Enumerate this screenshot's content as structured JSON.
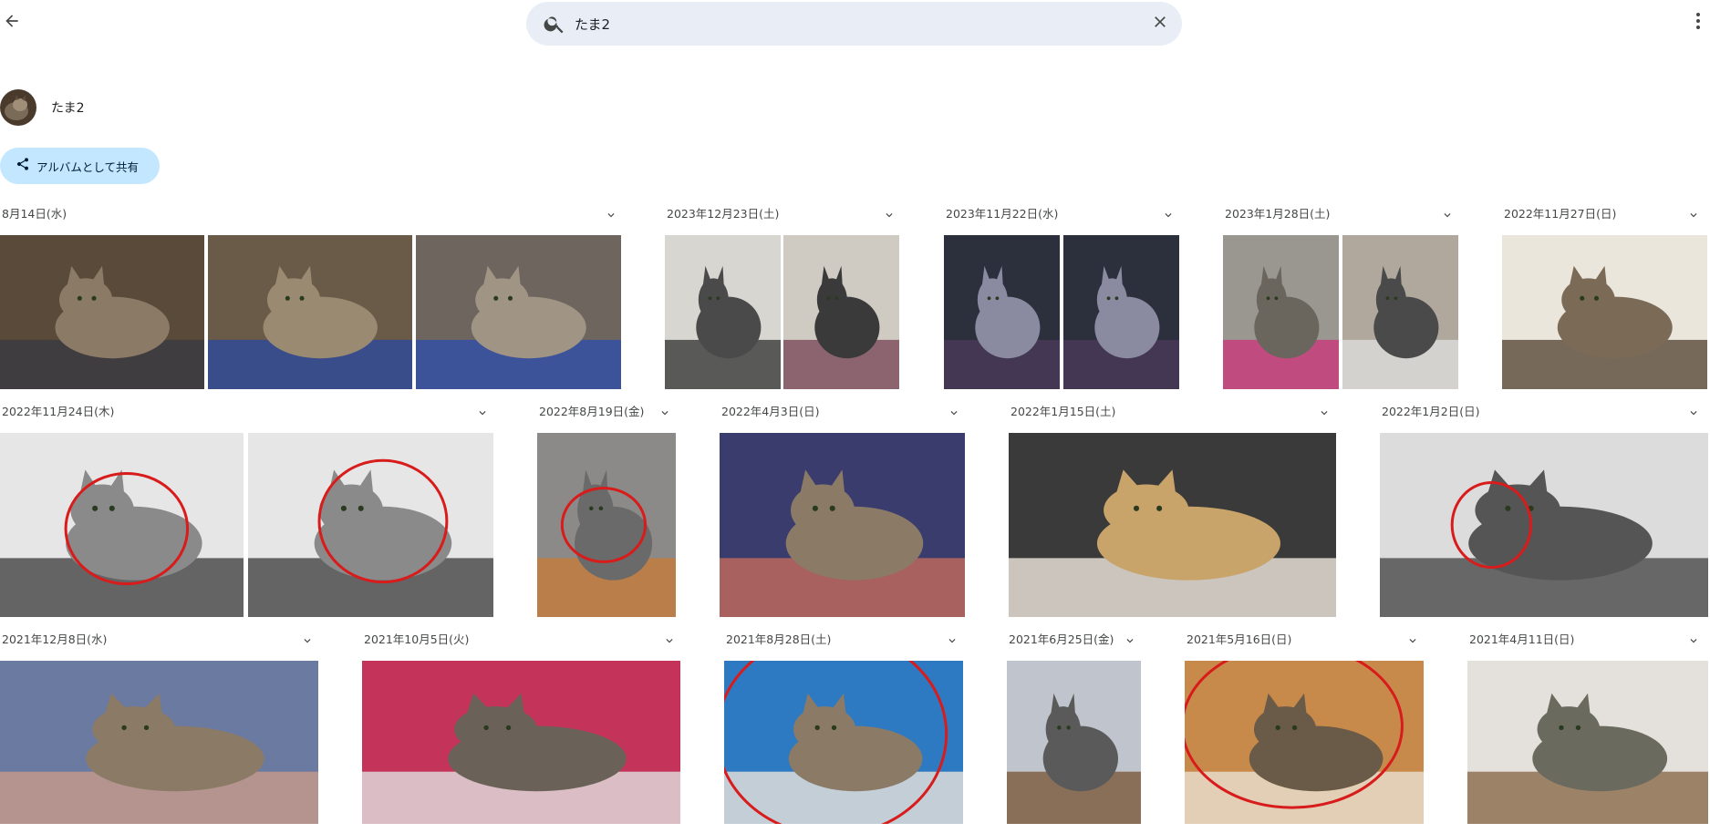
{
  "search": {
    "value": "たま2"
  },
  "person": {
    "name": "たま2"
  },
  "share": {
    "label": "アルバムとして共有"
  },
  "icons": {
    "back": "back-arrow-icon",
    "search": "search-icon",
    "clear": "close-icon",
    "more": "more-vert-icon",
    "share": "share-icon",
    "chevron": "chevron-down-icon"
  },
  "colors": {
    "search_bg": "#e9eef6",
    "share_bg": "#c2e7ff",
    "annotation": "#d81b1b"
  },
  "groups": [
    {
      "date": "8月14日(水)",
      "photos": 3
    },
    {
      "date": "2023年12月23日(土)",
      "photos": 2
    },
    {
      "date": "2023年11月22日(水)",
      "photos": 2
    },
    {
      "date": "2023年1月28日(土)",
      "photos": 2
    },
    {
      "date": "2022年11月27日(日)",
      "photos": 1
    },
    {
      "date": "2022年11月24日(木)",
      "photos": 2
    },
    {
      "date": "2022年8月19日(金)",
      "photos": 1
    },
    {
      "date": "2022年4月3日(日)",
      "photos": 1
    },
    {
      "date": "2022年1月15日(土)",
      "photos": 1
    },
    {
      "date": "2022年1月2日(日)",
      "photos": 1
    },
    {
      "date": "2021年12月8日(水)",
      "photos": 1
    },
    {
      "date": "2021年10月5日(火)",
      "photos": 1
    },
    {
      "date": "2021年8月28日(土)",
      "photos": 1
    },
    {
      "date": "2021年6月25日(金)",
      "photos": 1
    },
    {
      "date": "2021年5月16日(日)",
      "photos": 1
    },
    {
      "date": "2021年4月11日(日)",
      "photos": 1
    }
  ]
}
